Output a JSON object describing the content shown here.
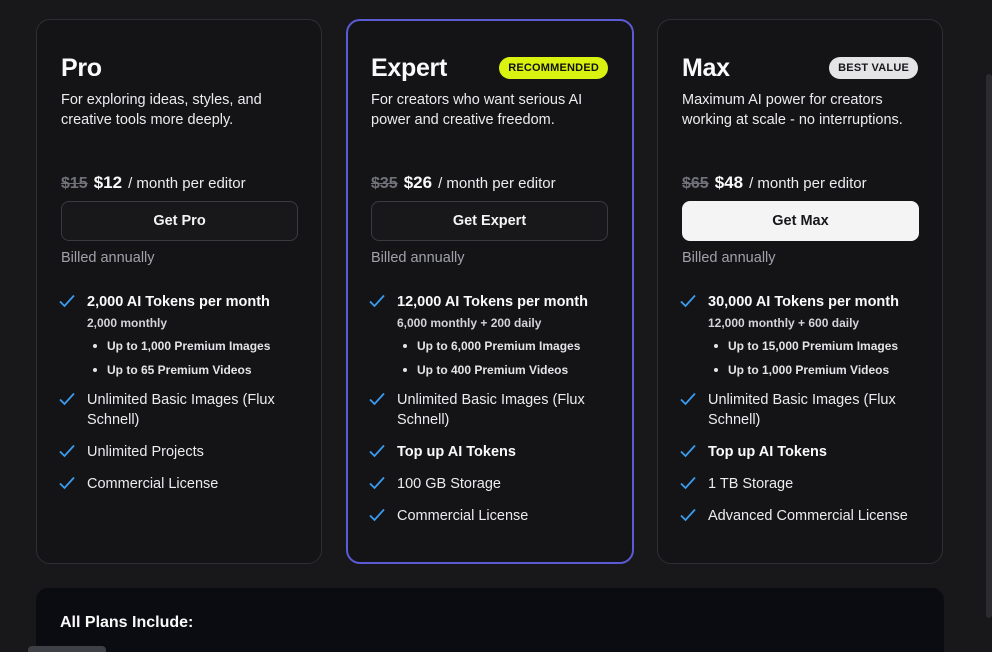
{
  "plans": [
    {
      "name": "Pro",
      "badge": "",
      "description": "For exploring ideas, styles, and creative tools more deeply.",
      "old_price": "$15",
      "new_price": "$12",
      "price_unit": "/ month per editor",
      "cta": "Get Pro",
      "billing": "Billed annually",
      "tokens": "2,000 AI Tokens per month",
      "tokens_sub": "2,000 monthly",
      "bullets": [
        "Up to 1,000 Premium Images",
        "Up to 65 Premium Videos"
      ],
      "features": [
        "Unlimited Basic Images (Flux Schnell)",
        "Unlimited Projects",
        "Commercial License"
      ]
    },
    {
      "name": "Expert",
      "badge": "RECOMMENDED",
      "description": "For creators who want serious AI power and creative freedom.",
      "old_price": "$35",
      "new_price": "$26",
      "price_unit": "/ month per editor",
      "cta": "Get Expert",
      "billing": "Billed annually",
      "tokens": "12,000 AI Tokens per month",
      "tokens_sub": "6,000 monthly + 200 daily",
      "bullets": [
        "Up to 6,000 Premium Images",
        "Up to 400 Premium Videos"
      ],
      "features": [
        "Unlimited Basic Images (Flux Schnell)",
        "Top up AI Tokens",
        "100 GB Storage",
        "Commercial License"
      ]
    },
    {
      "name": "Max",
      "badge": "BEST VALUE",
      "description": "Maximum AI power for creators working at scale - no interruptions.",
      "old_price": "$65",
      "new_price": "$48",
      "price_unit": "/ month per editor",
      "cta": "Get Max",
      "billing": "Billed annually",
      "tokens": "30,000 AI Tokens per month",
      "tokens_sub": "12,000 monthly + 600 daily",
      "bullets": [
        "Up to 15,000 Premium Images",
        "Up to 1,000 Premium Videos"
      ],
      "features": [
        "Unlimited Basic Images (Flux Schnell)",
        "Top up AI Tokens",
        "1 TB Storage",
        "Advanced Commercial License"
      ]
    }
  ],
  "all_plans": {
    "title": "All Plans Include:"
  },
  "colors": {
    "background": "#18181b",
    "card": "#141417",
    "accent_border": "#5b5bd6",
    "check": "#3b9cf0",
    "recommended_badge": "#d9f20f"
  },
  "icons": {
    "feature_check": "check-icon"
  }
}
